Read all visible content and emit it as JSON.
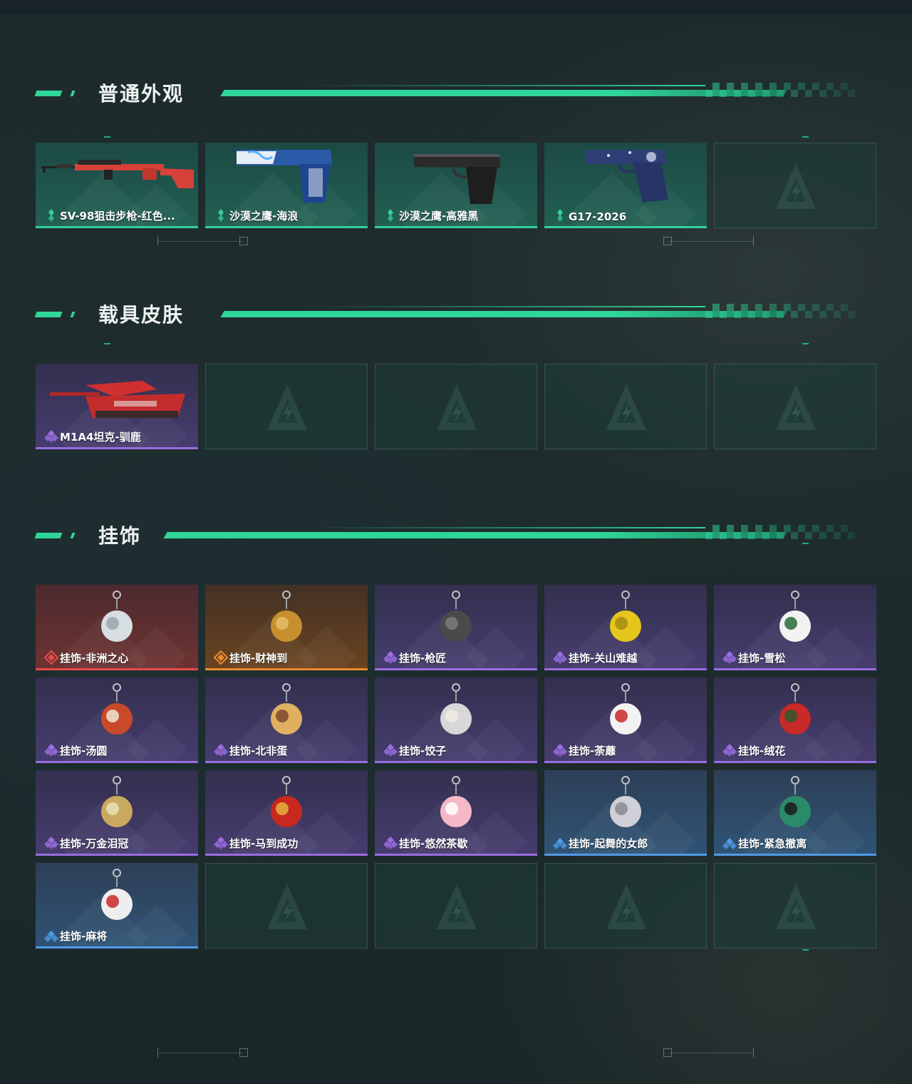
{
  "colors": {
    "accent": "#2fd69a",
    "rarity_green": "#35d09a",
    "rarity_purple": "#9a6de0",
    "rarity_red": "#e64b4b",
    "rarity_orange": "#ec8a2c",
    "rarity_blue": "#4f9be6"
  },
  "sections": [
    {
      "title": "普通外观",
      "items": [
        {
          "label": "SV-98狙击步枪-红色...",
          "rarity": "green",
          "icon": "sniper-rifle-red-icon"
        },
        {
          "label": "沙漠之鹰-海浪",
          "rarity": "green",
          "icon": "pistol-blue-wave-icon"
        },
        {
          "label": "沙漠之鹰-高雅黑",
          "rarity": "green",
          "icon": "pistol-black-icon"
        },
        {
          "label": "G17-2026",
          "rarity": "green",
          "icon": "pistol-navy-icon"
        },
        {
          "label": "",
          "rarity": "empty",
          "icon": "empty-slot-logo-icon"
        }
      ]
    },
    {
      "title": "载具皮肤",
      "items": [
        {
          "label": "M1A4坦克-驯鹿",
          "rarity": "purple",
          "icon": "tank-red-icon"
        },
        {
          "label": "",
          "rarity": "empty",
          "icon": "empty-slot-logo-icon"
        },
        {
          "label": "",
          "rarity": "empty",
          "icon": "empty-slot-logo-icon"
        },
        {
          "label": "",
          "rarity": "empty",
          "icon": "empty-slot-logo-icon"
        },
        {
          "label": "",
          "rarity": "empty",
          "icon": "empty-slot-logo-icon"
        }
      ]
    },
    {
      "title": "挂饰",
      "items": [
        {
          "label": "挂饰-非洲之心",
          "rarity": "red",
          "icon": "charm-diamond-icon"
        },
        {
          "label": "挂饰-财神到",
          "rarity": "orange",
          "icon": "charm-fortune-god-icon"
        },
        {
          "label": "挂饰-枪匠",
          "rarity": "purple",
          "icon": "charm-gunsmith-icon"
        },
        {
          "label": "挂饰-关山难越",
          "rarity": "purple",
          "icon": "charm-gold-bar-icon"
        },
        {
          "label": "挂饰-雪松",
          "rarity": "purple",
          "icon": "charm-snow-tree-icon"
        },
        {
          "label": "挂饰-汤圆",
          "rarity": "purple",
          "icon": "charm-tangyuan-icon"
        },
        {
          "label": "挂饰-北非蛋",
          "rarity": "purple",
          "icon": "charm-shakshuka-icon"
        },
        {
          "label": "挂饰-饺子",
          "rarity": "purple",
          "icon": "charm-dumpling-icon"
        },
        {
          "label": "挂饰-荼蘼",
          "rarity": "purple",
          "icon": "charm-flower-white-icon"
        },
        {
          "label": "挂饰-绒花",
          "rarity": "purple",
          "icon": "charm-red-flower-icon"
        },
        {
          "label": "挂饰-万金泪冠",
          "rarity": "purple",
          "icon": "charm-crown-egg-icon"
        },
        {
          "label": "挂饰-马到成功",
          "rarity": "purple",
          "icon": "charm-horse-icon"
        },
        {
          "label": "挂饰-悠然茶歇",
          "rarity": "purple",
          "icon": "charm-cupcake-icon"
        },
        {
          "label": "挂饰-起舞的女郎",
          "rarity": "blue",
          "icon": "charm-dancer-icon"
        },
        {
          "label": "挂饰-紧急撤离",
          "rarity": "blue",
          "icon": "charm-evac-sign-icon"
        },
        {
          "label": "挂饰-麻将",
          "rarity": "blue",
          "icon": "charm-mahjong-icon"
        },
        {
          "label": "",
          "rarity": "empty",
          "icon": "empty-slot-logo-icon"
        },
        {
          "label": "",
          "rarity": "empty",
          "icon": "empty-slot-logo-icon"
        },
        {
          "label": "",
          "rarity": "empty",
          "icon": "empty-slot-logo-icon"
        },
        {
          "label": "",
          "rarity": "empty",
          "icon": "empty-slot-logo-icon"
        }
      ]
    }
  ]
}
